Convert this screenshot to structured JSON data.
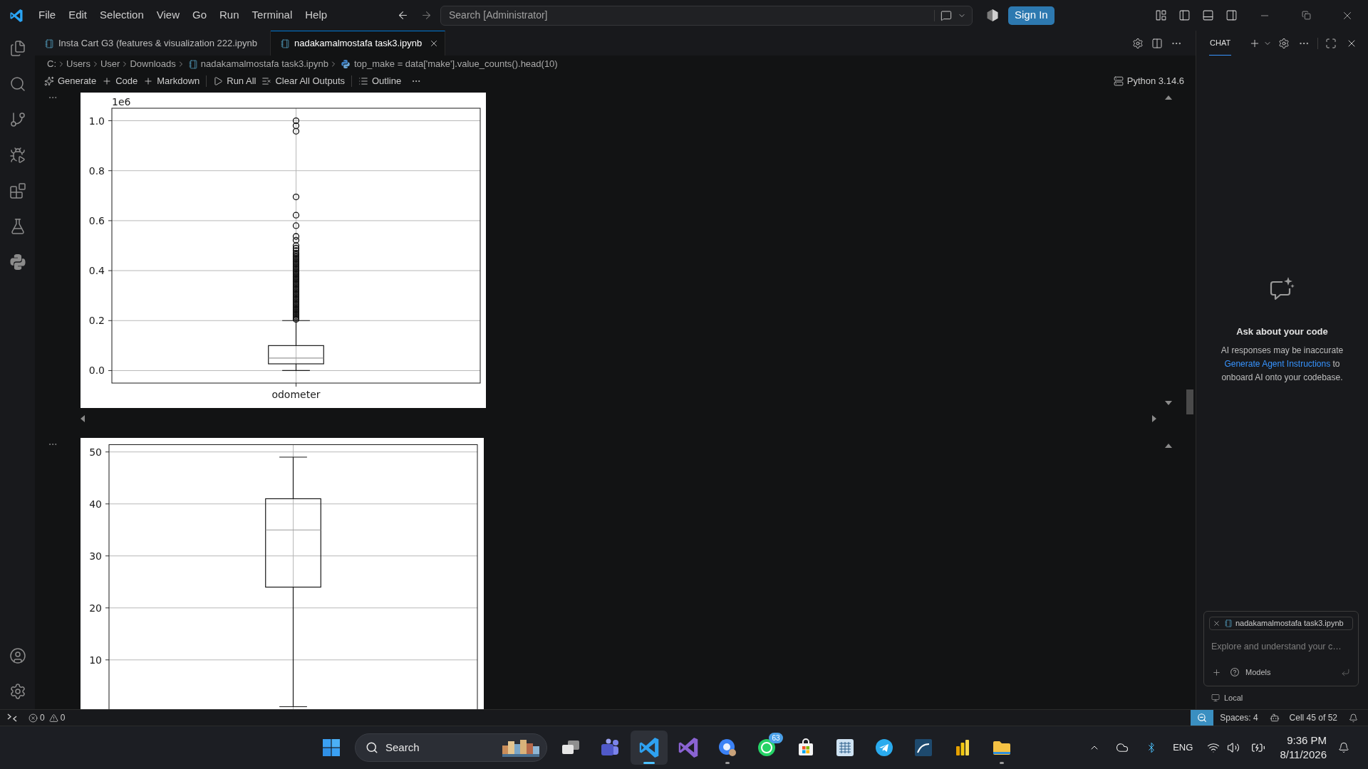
{
  "title_bar": {
    "menu": [
      "File",
      "Edit",
      "Selection",
      "View",
      "Go",
      "Run",
      "Terminal",
      "Help"
    ],
    "search": {
      "placeholder": "Search [Administrator]"
    },
    "sign_in": "Sign In"
  },
  "tabs": [
    {
      "label": "Insta Cart G3 (features & visualization 222.ipynb",
      "selected": false
    },
    {
      "label": "nadakamalmostafa task3.ipynb",
      "selected": true
    }
  ],
  "breadcrumb": [
    {
      "label": "C:",
      "kind": "folder"
    },
    {
      "label": "Users",
      "kind": "folder"
    },
    {
      "label": "User",
      "kind": "folder"
    },
    {
      "label": "Downloads",
      "kind": "folder"
    },
    {
      "label": "nadakamalmostafa task3.ipynb",
      "kind": "notebook"
    },
    {
      "label": "top_make = data['make'].value_counts().head(10)",
      "kind": "symbol"
    }
  ],
  "notebook_toolbar": {
    "actions": [
      {
        "label": "Generate",
        "kind": "generate"
      },
      {
        "label": "Code",
        "kind": "add"
      },
      {
        "label": "Markdown",
        "kind": "add"
      },
      {
        "label": "Run All",
        "kind": "run"
      },
      {
        "label": "Clear All Outputs",
        "kind": "clear"
      },
      {
        "label": "Outline",
        "kind": "outline"
      }
    ],
    "kernel": "Python 3.14.6"
  },
  "outputs": [
    {
      "chart_data": [
        {
          "type": "box",
          "ylim": [
            -0.05,
            1.05
          ],
          "yticks": [
            {
              "value": 0,
              "label": "0.0"
            },
            {
              "value": 0.2,
              "label": "0.2"
            },
            {
              "value": 0.4,
              "label": "0.4"
            },
            {
              "value": 0.6,
              "label": "0.6"
            },
            {
              "value": 0.8,
              "label": "0.8"
            },
            {
              "value": 1,
              "label": "1.0"
            }
          ],
          "annotations": [
            "1e6"
          ],
          "categories": [
            "odometer"
          ],
          "grid": true,
          "boxes": [
            {
              "low": 0,
              "q1": 0.027,
              "median": 0.05,
              "q3": 0.1,
              "high": 0.2,
              "outliers": [
                0.205,
                0.21,
                0.215,
                0.22,
                0.225,
                0.23,
                0.235,
                0.24,
                0.245,
                0.25,
                0.255,
                0.26,
                0.265,
                0.27,
                0.275,
                0.28,
                0.285,
                0.29,
                0.295,
                0.3,
                0.305,
                0.31,
                0.315,
                0.32,
                0.325,
                0.33,
                0.335,
                0.34,
                0.345,
                0.35,
                0.355,
                0.36,
                0.365,
                0.37,
                0.375,
                0.38,
                0.385,
                0.39,
                0.395,
                0.4,
                0.405,
                0.41,
                0.415,
                0.42,
                0.425,
                0.43,
                0.435,
                0.44,
                0.445,
                0.45,
                0.455,
                0.46,
                0.465,
                0.47,
                0.48,
                0.49,
                0.5,
                0.522,
                0.537,
                0.58,
                0.622,
                0.695,
                0.958,
                0.98,
                1
              ]
            }
          ]
        }
      ]
    },
    {
      "chart_data": [
        {
          "type": "box",
          "ylim": [
            -1.4,
            51.4
          ],
          "yticks": [
            10,
            20,
            30,
            40,
            50
          ],
          "categories": [
            null
          ],
          "grid": true,
          "boxes": [
            {
              "low": 1,
              "q1": 24,
              "median": 35,
              "q3": 41,
              "high": 49
            }
          ]
        }
      ]
    }
  ],
  "chat": {
    "tab": {
      "label": "CHAT",
      "selected": true
    },
    "heading": "Ask about your code",
    "disclaimer": {
      "text": "AI responses may be inaccurate",
      "link": "Generate Agent Instructions",
      "after": " to onboard AI onto your codebase."
    },
    "context_file": "nadakamalmostafa task3.ipynb",
    "input": {
      "placeholder": "Explore and understand your c…"
    },
    "model_picker": "Models",
    "mode": "Local"
  },
  "status_bar": {
    "errors": "0",
    "warnings": "0",
    "indentation": "Spaces: 4",
    "cell_position": "Cell 45 of 52"
  },
  "taskbar": {
    "search": {
      "placeholder": "Search"
    },
    "apps": [
      {
        "kind": "task-view",
        "running": false,
        "selected": false
      },
      {
        "kind": "teams",
        "running": false,
        "selected": false
      },
      {
        "kind": "vscode",
        "running": true,
        "selected": true
      },
      {
        "kind": "visual-studio",
        "running": false,
        "selected": false
      },
      {
        "kind": "browser",
        "running": true,
        "selected": false
      },
      {
        "kind": "whatsapp",
        "running": false,
        "selected": false,
        "badge": "63"
      },
      {
        "kind": "store",
        "running": false,
        "selected": false
      },
      {
        "kind": "tile-app",
        "running": false,
        "selected": false
      },
      {
        "kind": "telegram",
        "running": false,
        "selected": false
      },
      {
        "kind": "database",
        "running": false,
        "selected": false
      },
      {
        "kind": "power-bi",
        "running": false,
        "selected": false
      },
      {
        "kind": "file-explorer",
        "running": true,
        "selected": false
      }
    ],
    "tray": {
      "language": "ENG",
      "time": "9:36 PM",
      "date": "8/11/2026"
    }
  }
}
